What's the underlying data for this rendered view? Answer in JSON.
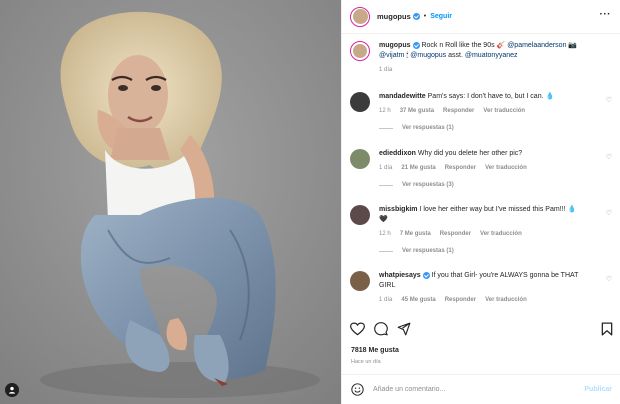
{
  "post": {
    "author": "mugopus",
    "follow_label": "Seguir",
    "separator": "•",
    "more_label": "···",
    "caption": {
      "author": "mugopus",
      "text_1": " Rock n Roll like the 90s 🎸 ",
      "mention_1": "@pamelaanderson",
      "text_2": " 📷",
      "mention_2": "@vijatm",
      "text_3": " 🕯 ",
      "mention_3": "@mugopus",
      "text_4": " asst. ",
      "mention_4": "@muatonyyanez",
      "time": "1 día"
    },
    "comments": [
      {
        "user": "mandadewitte",
        "text": " Pam's says: I don't have to, but I can. 💧",
        "time": "12 h",
        "likes": "37 Me gusta",
        "reply": "Responder",
        "translate": "Ver traducción",
        "view_replies": "Ver respuestas (1)"
      },
      {
        "user": "edieddixon",
        "text": " Why did you delete her other pic?",
        "time": "1 día",
        "likes": "21 Me gusta",
        "reply": "Responder",
        "translate": "Ver traducción",
        "view_replies": "Ver respuestas (3)"
      },
      {
        "user": "missbigkim",
        "text_line1": " I love her either way but I've missed this Pam!!! 💧",
        "text_line2": "🖤",
        "time": "12 h",
        "likes": "7 Me gusta",
        "reply": "Responder",
        "translate": "Ver traducción",
        "view_replies": "Ver respuestas (1)"
      },
      {
        "user": "whatpiesays",
        "text_line1": " If you that Girl- you're ALWAYS gonna be THAT",
        "text_line2": "GIRL",
        "time": "1 día",
        "likes": "45 Me gusta",
        "reply": "Responder",
        "translate": "Ver traducción"
      }
    ],
    "likes_total": "7818 Me gusta",
    "posted_ago": "Hace un día",
    "add_comment_placeholder": "Añade un comentario...",
    "publish_label": "Publicar"
  },
  "colors": {
    "accent": "#0095f6",
    "verified": "#3897f0",
    "muted": "#8e8e8e"
  },
  "icons": [
    "user-tag-icon",
    "verified-icon",
    "heart-icon",
    "comment-icon",
    "share-icon",
    "bookmark-icon",
    "emoji-icon",
    "more-icon"
  ]
}
